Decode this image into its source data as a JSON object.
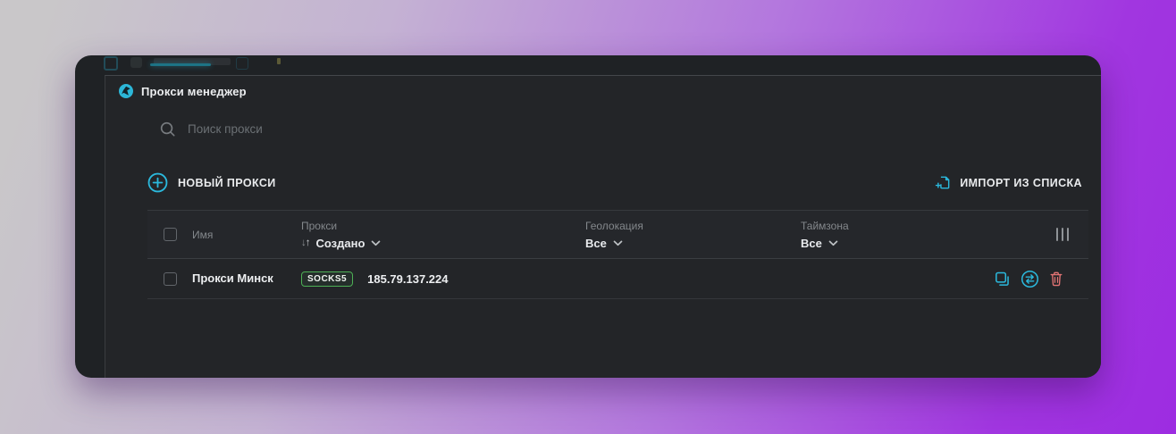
{
  "app": {
    "title": "Прокси менеджер"
  },
  "search": {
    "placeholder": "Поиск прокси",
    "value": ""
  },
  "toolbar": {
    "new_proxy_label": "НОВЫЙ ПРОКСИ",
    "import_label": "ИМПОРТ ИЗ СПИСКА"
  },
  "table": {
    "columns": {
      "name": "Имя",
      "proxy": "Прокси",
      "proxy_sort": "Создано",
      "geolocation": "Геолокация",
      "geolocation_filter": "Все",
      "timezone": "Таймзона",
      "timezone_filter": "Все"
    },
    "rows": [
      {
        "name": "Прокси Минск",
        "protocol": "SOCKS5",
        "address": "185.79.137.224"
      }
    ]
  },
  "colors": {
    "accent_cyan": "#2bb9dd",
    "protocol_green": "#4db055",
    "danger_red": "#e27474",
    "panel_bg": "#232528",
    "window_bg": "#1f2225",
    "background_purple": "#9d2ce1"
  }
}
